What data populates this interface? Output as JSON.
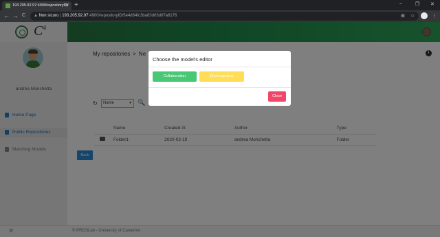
{
  "browser": {
    "tab_title": "193.205.92.97:4900/repositoryID/",
    "new_tab": "+",
    "controls": {
      "minimize": "–",
      "restore": "❐",
      "close": "✕"
    },
    "nav": {
      "back": "←",
      "forward": "→",
      "reload": "C"
    },
    "security_label": "Non sicuro",
    "url_host": "193.205.92.97",
    "url_path": ":4900/repositoryID/5e4d64fc3ba83d03d07a8176"
  },
  "app": {
    "logo_text": "C",
    "logo_sup": "4",
    "user_name": "andrea Morichetta",
    "nav": [
      {
        "label": "Home Page"
      },
      {
        "label": "Public Repositories"
      },
      {
        "label": "Matching Models"
      }
    ],
    "breadcrumb": {
      "root": "My repositories",
      "sep": ">",
      "current": "Ne"
    },
    "info_label": "i",
    "search": {
      "select_value": "Name",
      "caret": "▼",
      "refresh": "↻",
      "search": "🔍"
    },
    "table": {
      "headers": [
        "Name",
        "Created At",
        "Author",
        "Type"
      ],
      "rows": [
        {
          "name": "Folder1",
          "created_at": "2020-02-19",
          "author": "andrea Morichetta",
          "type": "Folder"
        }
      ]
    },
    "back_label": "Back",
    "footer": {
      "gear": "⚙",
      "copyright": "© PROSLab - University of Camerino"
    }
  },
  "modal": {
    "title": "Choose the model's editor",
    "collaboration_label": "Collaboration",
    "choreography_label": "Choreography",
    "close_label": "Close"
  },
  "colors": {
    "collaboration": "#48c774",
    "choreography": "#ffdd57",
    "close": "#f14668",
    "back": "#2d8ad6",
    "topbar_green": "#1e8a4a"
  }
}
